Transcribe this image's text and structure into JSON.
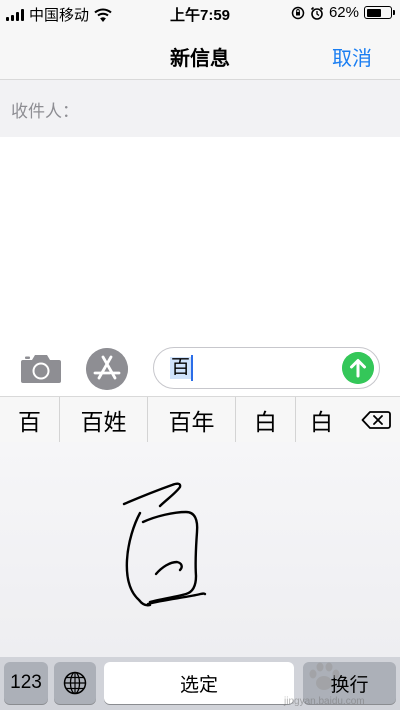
{
  "status_bar": {
    "carrier": "中国移动",
    "time": "上午7:59",
    "battery": "62%",
    "battery_level": 0.62
  },
  "nav": {
    "title": "新信息",
    "cancel": "取消"
  },
  "recipient": {
    "label": "收件人："
  },
  "composer": {
    "text": "百"
  },
  "suggestions": [
    "百",
    "百姓",
    "百年",
    "白",
    "白"
  ],
  "keyboard": {
    "numbers": "123",
    "select": "选定",
    "return": "换行"
  },
  "watermark": {
    "text": "jingyan.baidu.com"
  }
}
